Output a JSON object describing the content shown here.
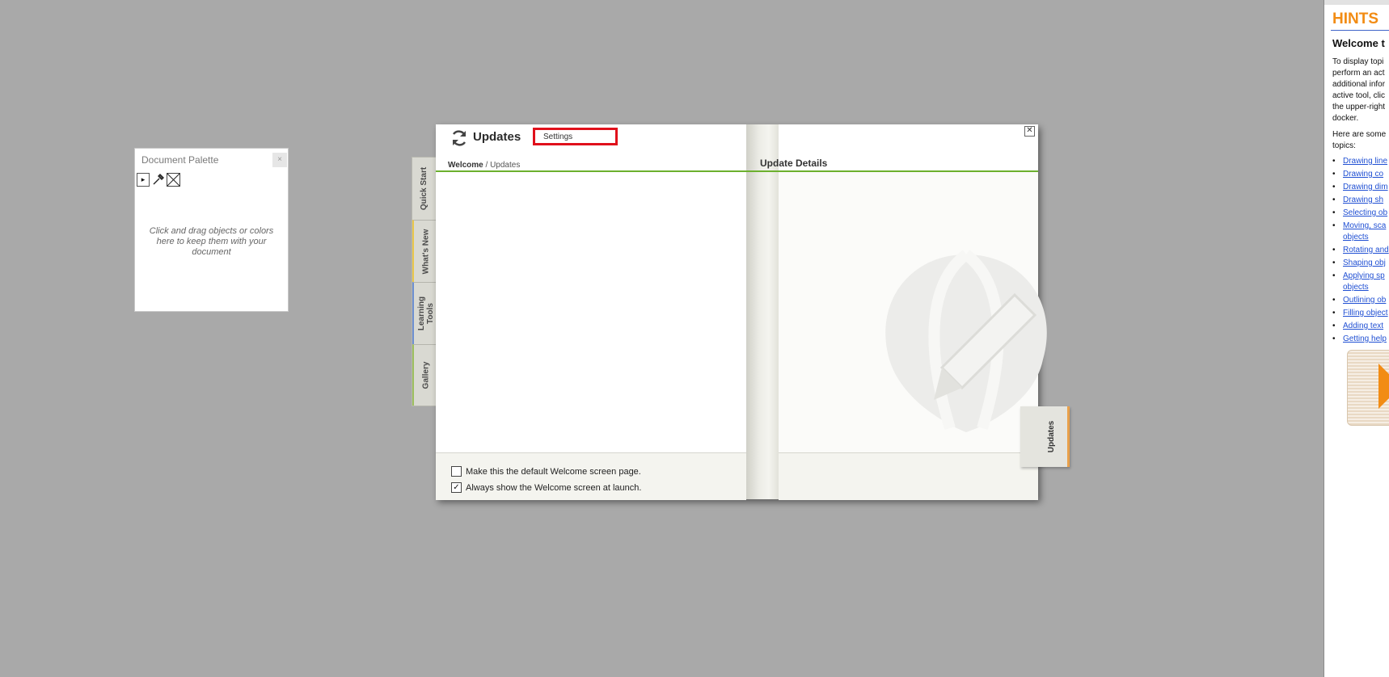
{
  "document_palette": {
    "title": "Document Palette",
    "close_label": "×",
    "hint": "Click and drag objects or colors here to keep them with your document",
    "tools": [
      "play-icon",
      "eyedropper-icon",
      "no-color-icon"
    ]
  },
  "welcome": {
    "title": "Updates",
    "settings_label": "Settings",
    "close_label": "✕",
    "breadcrumb_root": "Welcome",
    "breadcrumb_sep": " / ",
    "breadcrumb_current": "Updates",
    "details_title": "Update Details",
    "side_tabs": [
      "Quick Start",
      "What's New",
      "Learning Tools",
      "Gallery"
    ],
    "active_tab": "Updates",
    "checkboxes": [
      {
        "label": "Make this the default Welcome screen page.",
        "checked": false
      },
      {
        "label": "Always show the Welcome screen at launch.",
        "checked": true
      }
    ],
    "accent_color": "#6cb02e",
    "highlight_color": "#e0101b"
  },
  "hints": {
    "title": "HINTS",
    "welcome": "Welcome t",
    "intro_lines": [
      "To display topi",
      "perform an act",
      "additional infor",
      "active tool, clic",
      "the upper-right",
      "docker."
    ],
    "here_lines": [
      "Here are some",
      "topics:"
    ],
    "links": [
      "Drawing line",
      "Drawing co",
      "Drawing dim",
      "Drawing sh",
      "Selecting ob",
      "Moving, sca objects",
      "Rotating and",
      "Shaping obj",
      "Applying sp objects",
      "Outlining ob",
      "Filling object",
      "Adding text",
      "Getting help"
    ],
    "title_color": "#f28c14",
    "link_color": "#1f4fd3"
  }
}
